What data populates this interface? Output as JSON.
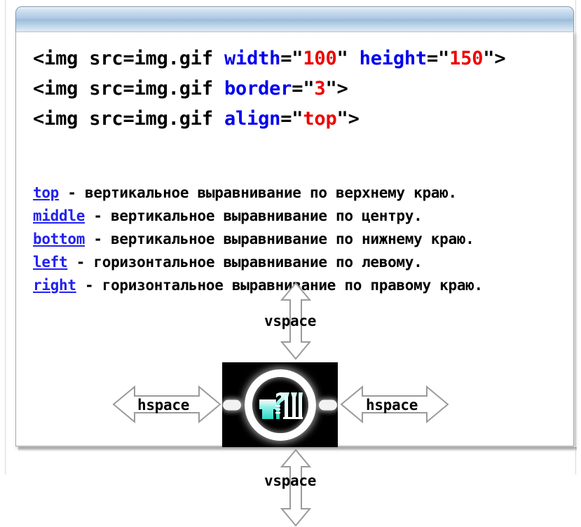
{
  "window": {
    "title": "",
    "title_bar_color": "#aec9e4",
    "frame_border_color": "#a9a9a9"
  },
  "code": {
    "accent_attribute_color": "#0000ee",
    "accent_value_color": "#ee0000",
    "lines": [
      {
        "id": "img-width-height",
        "prefix": "<img src=img.gif ",
        "attr1": "width",
        "eq1": "=\"",
        "val1": "100",
        "mid": "\" ",
        "attr2": "height",
        "eq2": "=\"",
        "val2": "150",
        "suffix": "\">"
      },
      {
        "id": "img-border",
        "prefix": "<img src=img.gif ",
        "attr1": "border",
        "eq1": "=\"",
        "val1": "3",
        "suffix": "\">"
      },
      {
        "id": "img-align",
        "prefix": "<img src=img.gif ",
        "attr1": "align",
        "eq1": "=\"",
        "val1": "top",
        "suffix": "\">"
      }
    ]
  },
  "align_list": {
    "keyword_color": "#2222ee",
    "rows": [
      {
        "keyword": "top",
        "description": " - вертикальное выравнивание по верхнему краю."
      },
      {
        "keyword": "middle",
        "description": " - вертикальное выравнивание по центру."
      },
      {
        "keyword": "bottom",
        "description": " - вертикальное выравнивание по нижнему краю."
      },
      {
        "keyword": "left",
        "description": " - горизонтальное выравнивание по левому."
      },
      {
        "keyword": "right",
        "description": " - горизонтальное выравнивание по правому краю."
      }
    ]
  },
  "diagram": {
    "vspace_top_label": "vspace",
    "vspace_bottom_label": "vspace",
    "hspace_left_label": "hspace",
    "hspace_right_label": "hspace",
    "arrow_outline_color": "#9a9a9a",
    "arrow_fill_color": "#ffffff",
    "picture": {
      "background_color": "#000000",
      "ring_color": "#ffffff",
      "glyph_accent_color": "#3ee0d0"
    }
  }
}
